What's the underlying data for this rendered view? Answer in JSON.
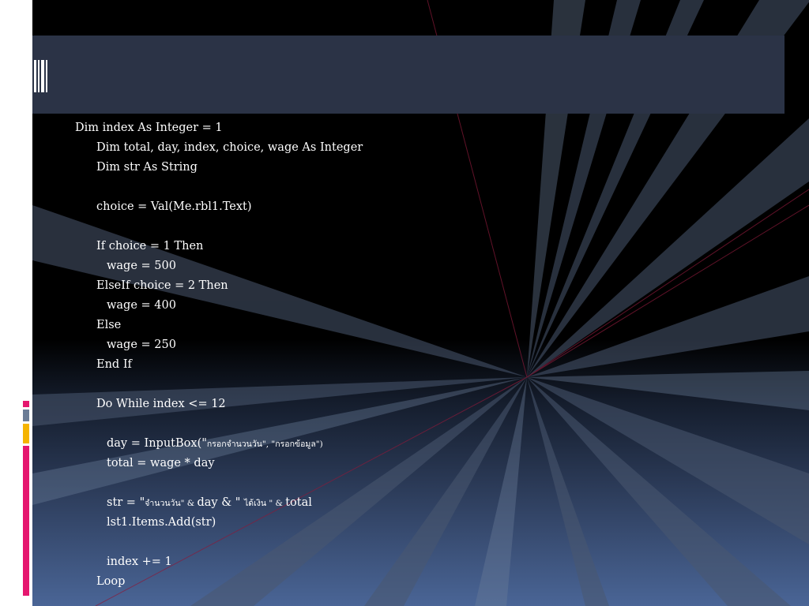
{
  "slide": {
    "title": "",
    "colors": {
      "background": "#000000",
      "title_band": "#2b3346",
      "gradient_bottom": "#4a6596",
      "accent_pink": "#e5176f",
      "accent_gray": "#6b7c96",
      "accent_gold": "#f5b400",
      "code_text": "#ffffff"
    },
    "code_lines": [
      {
        "indent": 0,
        "text": "Dim index As Integer = 1"
      },
      {
        "indent": 1,
        "text": "Dim total, day, index, choice, wage As Integer"
      },
      {
        "indent": 1,
        "text": "Dim str As String"
      },
      {
        "indent": 1,
        "text": ""
      },
      {
        "indent": 1,
        "text": "choice = Val(Me.rbl1.Text)"
      },
      {
        "indent": 1,
        "text": ""
      },
      {
        "indent": 1,
        "text": "If choice = 1 Then"
      },
      {
        "indent": 2,
        "text": "wage = 500"
      },
      {
        "indent": 1,
        "text": "ElseIf choice = 2 Then"
      },
      {
        "indent": 2,
        "text": "wage = 400"
      },
      {
        "indent": 1,
        "text": "Else"
      },
      {
        "indent": 2,
        "text": "wage = 250"
      },
      {
        "indent": 1,
        "text": "End If"
      },
      {
        "indent": 1,
        "text": ""
      },
      {
        "indent": 1,
        "text": "Do While index <= 12"
      },
      {
        "indent": 2,
        "text": ""
      },
      {
        "indent": 2,
        "pre": "day = InputBox(\"",
        "small": "กรอกจำนวนวัน\", \"กรอกข้อมูล\")"
      },
      {
        "indent": 2,
        "text": "total = wage * day"
      },
      {
        "indent": 2,
        "text": ""
      },
      {
        "indent": 2,
        "pre": "str = \"",
        "small": "จำนวนวัน\" & ",
        "mid": "day & \" ",
        "small2": "ได้เงิน \" & ",
        "post": "total"
      },
      {
        "indent": 2,
        "text": "lst1.Items.Add(str)"
      },
      {
        "indent": 2,
        "text": ""
      },
      {
        "indent": 2,
        "text": "index += 1"
      },
      {
        "indent": 1,
        "text": "Loop"
      }
    ]
  }
}
